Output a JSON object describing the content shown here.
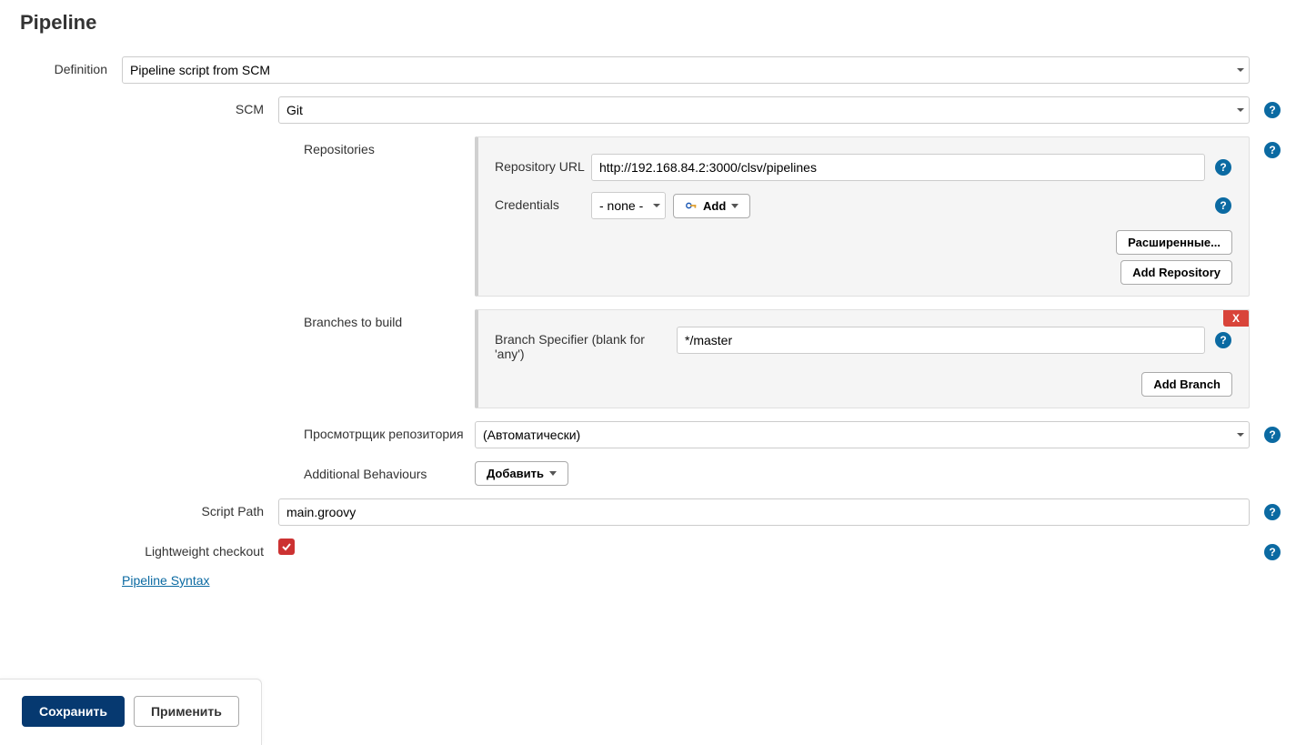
{
  "section_title": "Pipeline",
  "definition": {
    "label": "Definition",
    "value": "Pipeline script from SCM"
  },
  "scm": {
    "label": "SCM",
    "value": "Git"
  },
  "repositories": {
    "label": "Repositories",
    "url_label": "Repository URL",
    "url_value": "http://192.168.84.2:3000/clsv/pipelines",
    "credentials_label": "Credentials",
    "credentials_value": "- none -",
    "add_button": "Add",
    "advanced_button": "Расширенные...",
    "add_repo_button": "Add Repository"
  },
  "branches": {
    "label": "Branches to build",
    "specifier_label": "Branch Specifier (blank for 'any')",
    "specifier_value": "*/master",
    "remove_x": "X",
    "add_branch_button": "Add Branch"
  },
  "browser": {
    "label": "Просмотрщик репозитория",
    "value": "(Автоматически)"
  },
  "behaviours": {
    "label": "Additional Behaviours",
    "add_button": "Добавить"
  },
  "script_path": {
    "label": "Script Path",
    "value": "main.groovy"
  },
  "lightweight": {
    "label": "Lightweight checkout",
    "checked": true
  },
  "pipeline_syntax_link": "Pipeline Syntax",
  "buttons": {
    "save": "Сохранить",
    "apply": "Применить"
  }
}
